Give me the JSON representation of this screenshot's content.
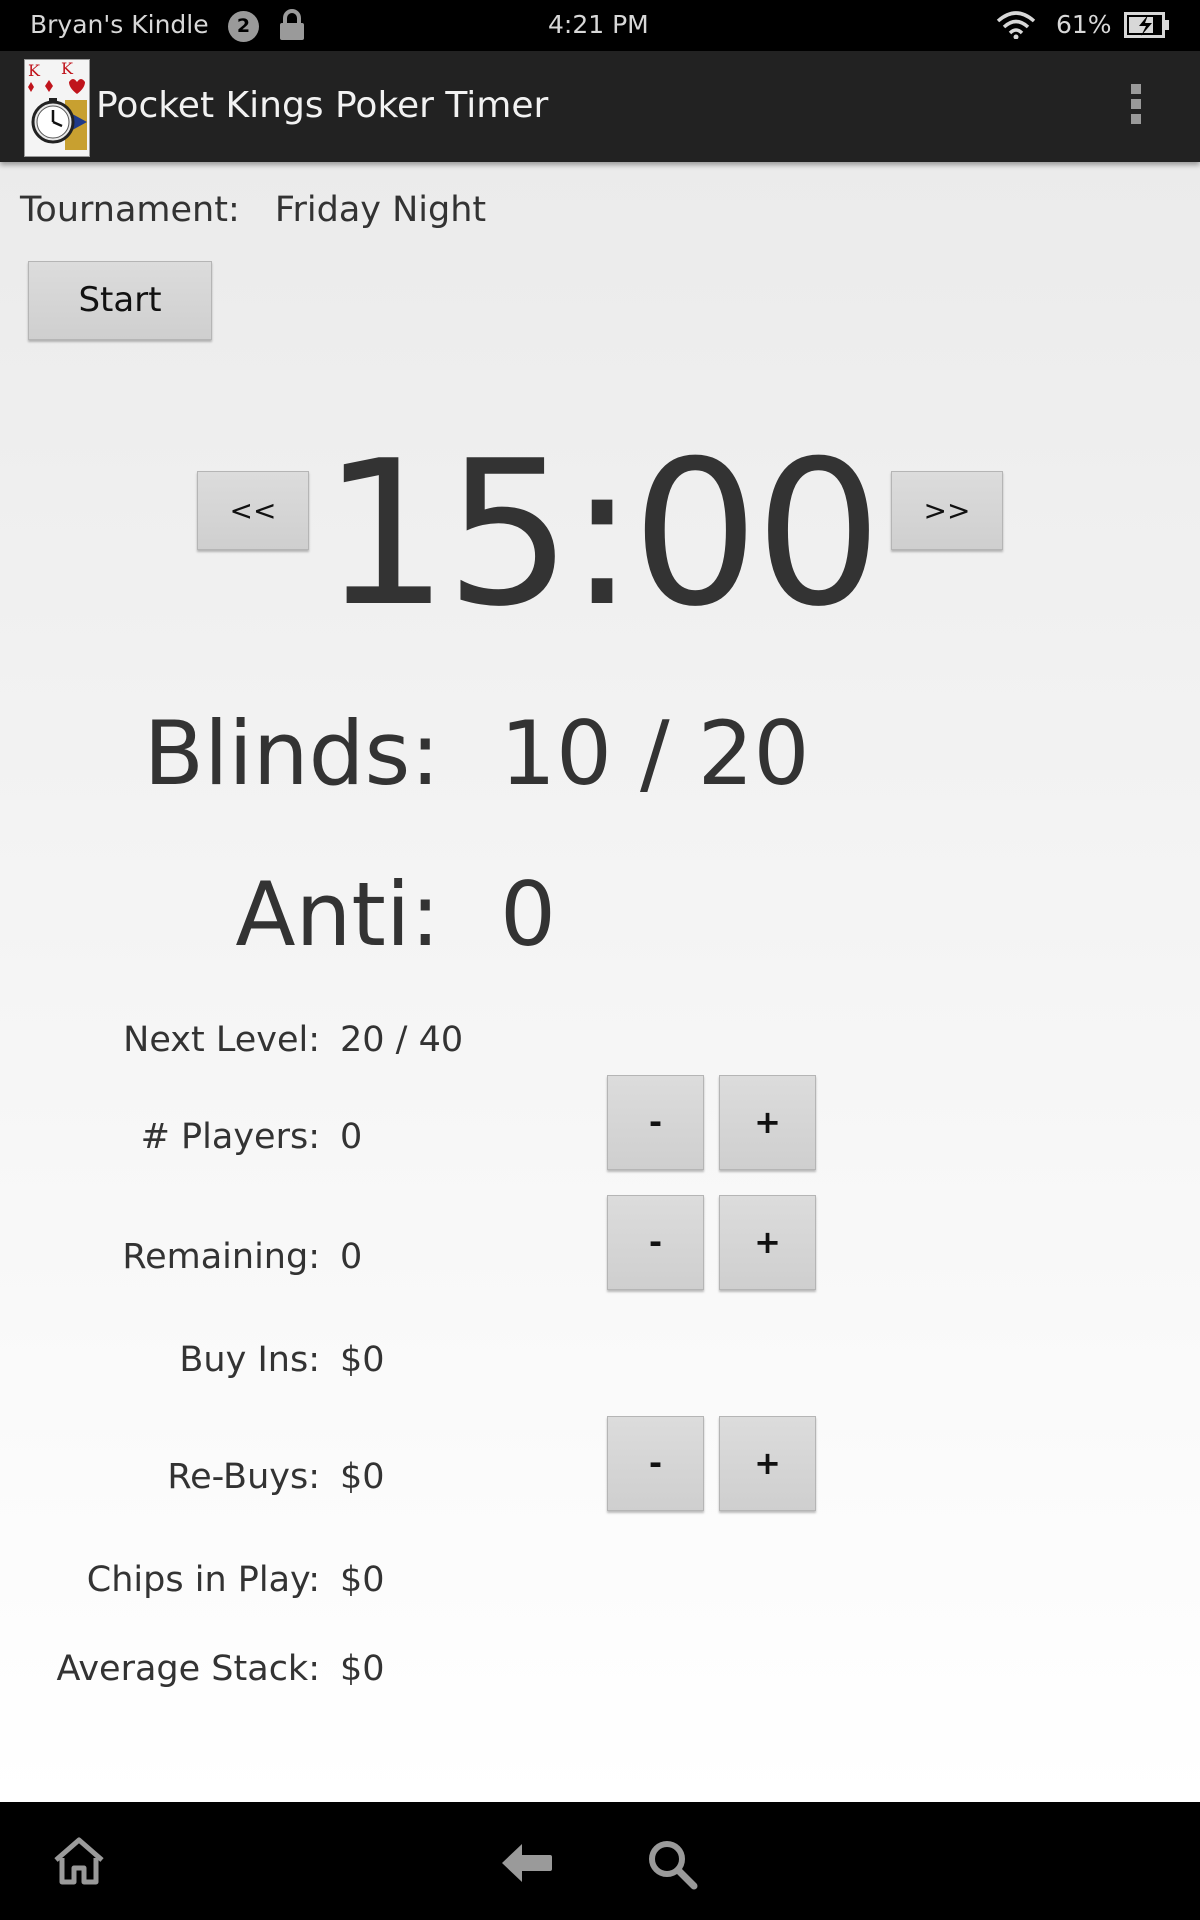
{
  "status_bar": {
    "device_name": "Bryan's Kindle",
    "notification_count": "2",
    "time": "4:21 PM",
    "battery_percent": "61%",
    "icons": [
      "lock-icon",
      "wifi-icon",
      "battery-charging-icon"
    ]
  },
  "action_bar": {
    "title": "Pocket Kings Poker Timer",
    "icon": "king-cards-clock-icon",
    "menu_icon": "overflow-menu-icon"
  },
  "tournament": {
    "label": "Tournament:",
    "name": "Friday Night"
  },
  "controls": {
    "start_label": "Start",
    "prev_label": "<<",
    "next_label": ">>"
  },
  "timer": "15:00",
  "blinds": {
    "label": "Blinds:",
    "value": "10 / 20"
  },
  "anti": {
    "label": "Anti:",
    "value": "0"
  },
  "stats": {
    "next_level": {
      "label": "Next Level:",
      "value": "20 / 40"
    },
    "players": {
      "label": "# Players:",
      "value": "0"
    },
    "remaining": {
      "label": "Remaining:",
      "value": "0"
    },
    "buy_ins": {
      "label": "Buy Ins:",
      "value": "$0"
    },
    "re_buys": {
      "label": "Re-Buys:",
      "value": "$0"
    },
    "chips_in_play": {
      "label": "Chips in Play:",
      "value": "$0"
    },
    "average_stack": {
      "label": "Average Stack:",
      "value": "$0"
    }
  },
  "steppers": {
    "minus_label": "-",
    "plus_label": "+"
  },
  "nav_bar": {
    "icons": [
      "home-icon",
      "back-icon",
      "search-icon"
    ]
  }
}
